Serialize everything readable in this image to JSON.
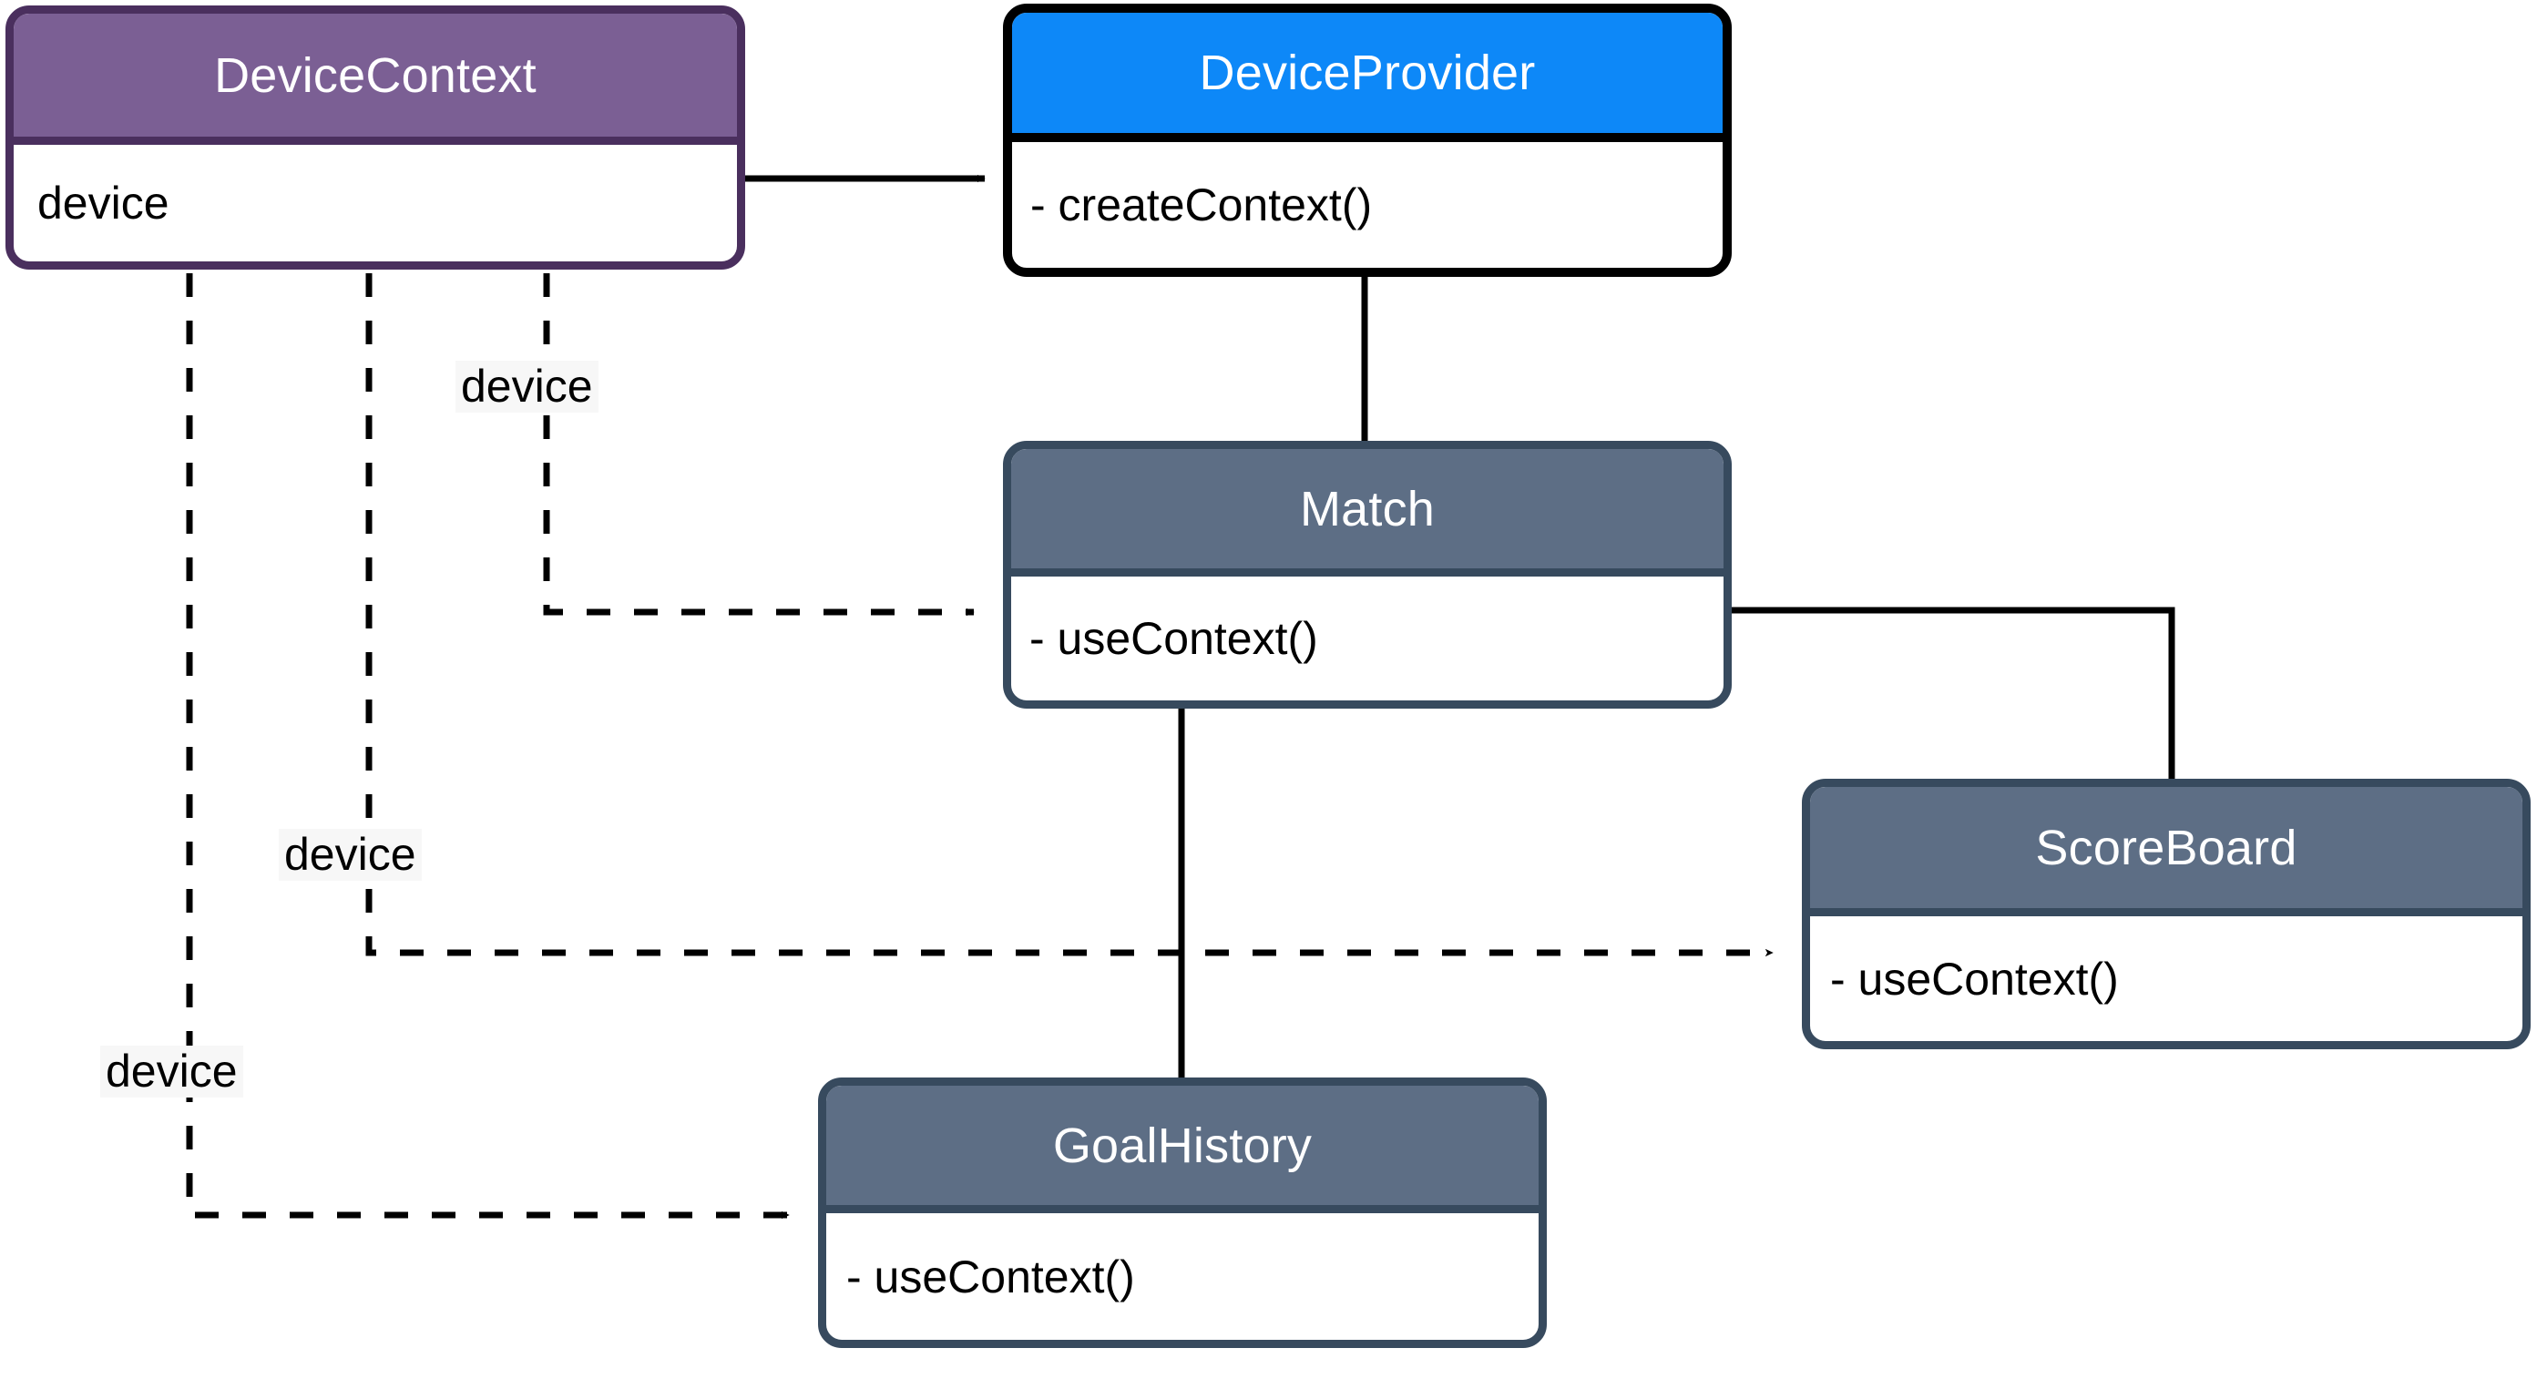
{
  "diagram": {
    "title": "React Context UML class diagram",
    "type": "uml-class-diagram",
    "background_color": "#ffffff",
    "classes": [
      {
        "id": "devicecontext",
        "name": "DeviceContext",
        "members": [
          "device"
        ],
        "header_color": "#7b5f94",
        "border_color": "#4a2f5e",
        "body_color": "#ffffff"
      },
      {
        "id": "deviceprovider",
        "name": "DeviceProvider",
        "members": [
          "- createContext()"
        ],
        "header_color": "#0d88f8",
        "border_color": "#000000",
        "body_color": "#ffffff"
      },
      {
        "id": "match",
        "name": "Match",
        "members": [
          "- useContext()"
        ],
        "header_color": "#5d6e85",
        "border_color": "#374a5e",
        "body_color": "#ffffff"
      },
      {
        "id": "scoreboard",
        "name": "ScoreBoard",
        "members": [
          "- useContext()"
        ],
        "header_color": "#5d6e85",
        "border_color": "#374a5e",
        "body_color": "#ffffff"
      },
      {
        "id": "goalhistory",
        "name": "GoalHistory",
        "members": [
          "- useContext()"
        ],
        "header_color": "#5d6e85",
        "border_color": "#374a5e",
        "body_color": "#ffffff"
      }
    ],
    "edges": [
      {
        "id": "ctx-to-provider",
        "from": "DeviceContext",
        "to": "DeviceProvider",
        "style": "solid",
        "arrow": "filled-triangle",
        "label": ""
      },
      {
        "id": "provider-to-match",
        "from": "DeviceProvider",
        "to": "Match",
        "style": "solid",
        "arrow": "none",
        "label": ""
      },
      {
        "id": "match-to-scoreboard",
        "from": "Match",
        "to": "ScoreBoard",
        "style": "solid",
        "arrow": "none",
        "label": ""
      },
      {
        "id": "match-to-goalhistory",
        "from": "Match",
        "to": "GoalHistory",
        "style": "solid",
        "arrow": "none",
        "label": ""
      },
      {
        "id": "ctx-to-match",
        "from": "DeviceContext",
        "to": "Match",
        "style": "dashed",
        "arrow": "filled-triangle",
        "label": "device"
      },
      {
        "id": "ctx-to-scoreboard",
        "from": "DeviceContext",
        "to": "ScoreBoard",
        "style": "dashed",
        "arrow": "filled-triangle",
        "label": "device"
      },
      {
        "id": "ctx-to-goalhistory",
        "from": "DeviceContext",
        "to": "GoalHistory",
        "style": "dashed",
        "arrow": "filled-triangle",
        "label": "device"
      }
    ],
    "edge_labels": {
      "to_match": "device",
      "to_scoreboard": "device",
      "to_goalhistory": "device"
    }
  }
}
